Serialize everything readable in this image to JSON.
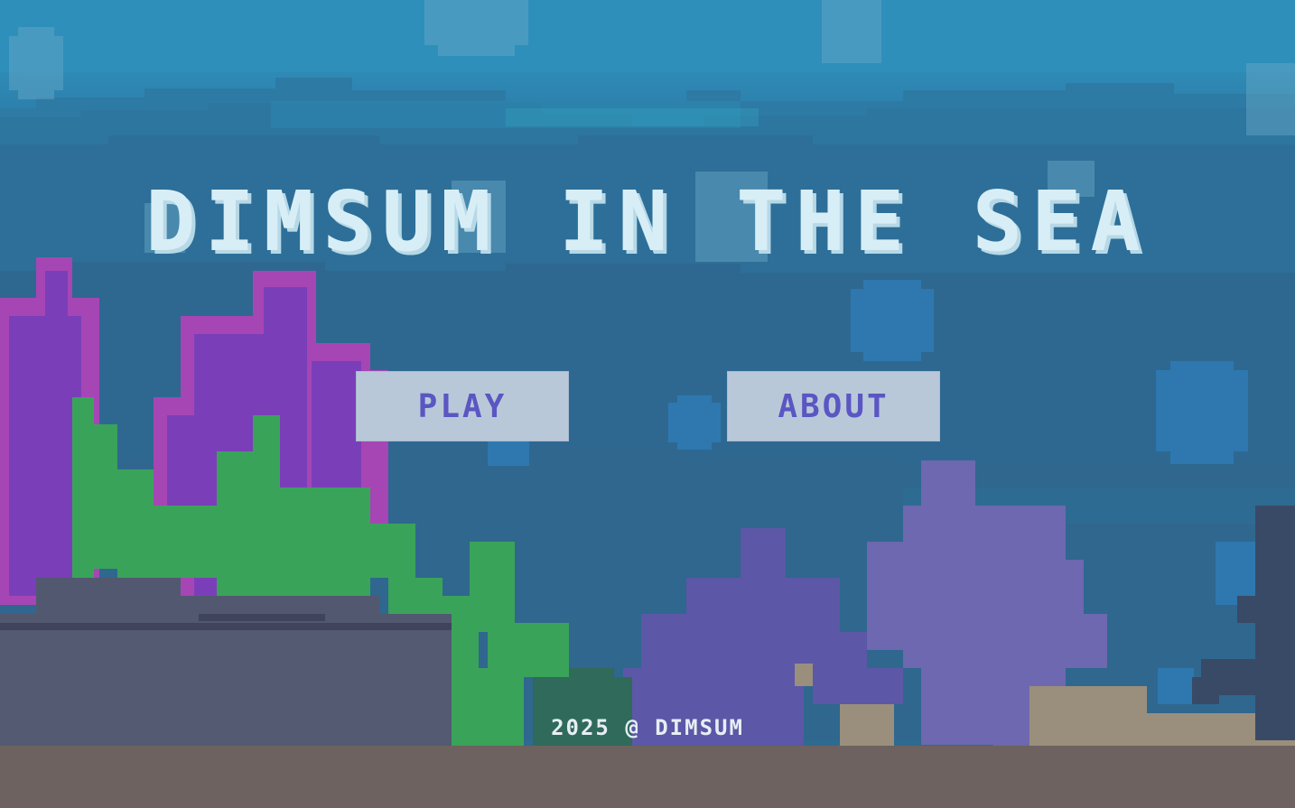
{
  "game": {
    "title": "DIMSUM IN THE SEA",
    "menu": {
      "play_label": "PLAY",
      "about_label": "ABOUT"
    },
    "footer": "2025 @ DIMSUM"
  },
  "colors": {
    "title": "#d8eef6",
    "button_bg": "#b9c8d9",
    "button_text": "#5a56c2",
    "coral_purple": "#7a3fb8",
    "coral_magenta": "#a546b4",
    "seaweed_green": "#3aa35a",
    "rock": "#525870",
    "coral_violet": "#6d68b0",
    "ground": "#6d625f"
  }
}
